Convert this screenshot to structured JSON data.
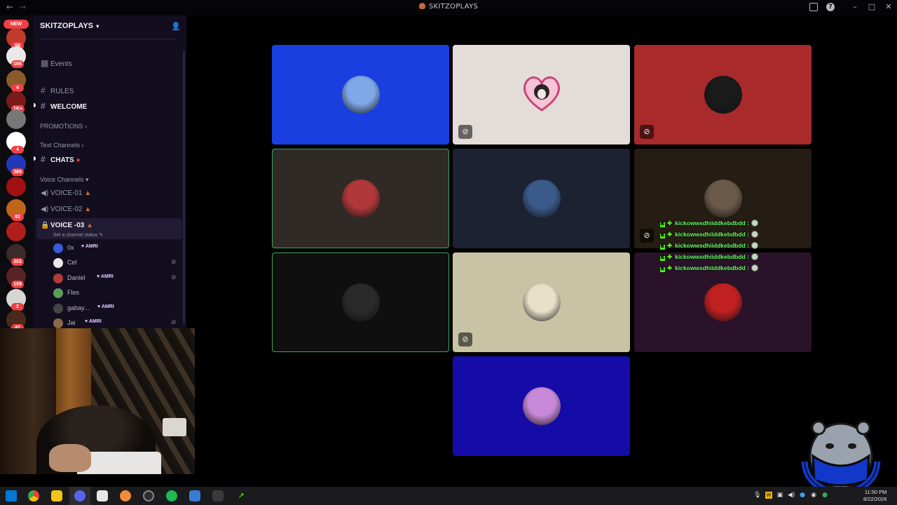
{
  "window": {
    "title": "SKITZOPLAYS"
  },
  "rail": {
    "new_badge": "NEW",
    "servers": [
      {
        "badge": "58",
        "color": "#c0392b"
      },
      {
        "badge": "166",
        "color": "#e9e9e9"
      },
      {
        "badge": "4",
        "color": "#8b5a2b"
      },
      {
        "badge": "1K+",
        "color": "#7a1b1b"
      },
      {
        "badge": "",
        "color": "#777777"
      },
      {
        "badge": "4",
        "color": "#ffffff"
      },
      {
        "badge": "389",
        "color": "#2338b8"
      },
      {
        "badge": "",
        "color": "#a01010"
      },
      {
        "badge": "82",
        "color": "#c0651a"
      },
      {
        "badge": "",
        "color": "#b11d1d"
      },
      {
        "badge": "302",
        "color": "#3a2a2a"
      },
      {
        "badge": "199",
        "color": "#5a2323"
      },
      {
        "badge": "2",
        "color": "#d6d6d6"
      },
      {
        "badge": "42",
        "color": "#4a2a1a"
      }
    ]
  },
  "sidebar": {
    "server_name": "SKITZOPLAYS",
    "events": "Events",
    "channels_top": [
      {
        "name": "RULES",
        "bold": false
      },
      {
        "name": "WELCOME",
        "bold": true
      }
    ],
    "cat_promotions": "PROMOTIONS",
    "cat_text": "Text Channels",
    "chats": "CHATS",
    "cat_voice": "Voice Channels",
    "voice": [
      {
        "name": "VOICE-01"
      },
      {
        "name": "VOICE-02"
      },
      {
        "name": "VOICE -03"
      }
    ],
    "channel_status": "Set a channel status",
    "members": [
      {
        "name": "0x",
        "tag": "AMRI",
        "muted": false,
        "color": "#3a5bd9"
      },
      {
        "name": "Cel",
        "tag": "",
        "muted": true,
        "color": "#e8e8e8"
      },
      {
        "name": "Daniel",
        "tag": "AMRI",
        "muted": true,
        "color": "#b33a3a"
      },
      {
        "name": "Fles",
        "tag": "",
        "muted": false,
        "color": "#5a9a5a"
      },
      {
        "name": "gabay...",
        "tag": "AMRI",
        "muted": false,
        "color": "#444444"
      },
      {
        "name": "Jai",
        "tag": "AMRI",
        "muted": true,
        "color": "#8a6a4a"
      }
    ]
  },
  "tiles": [
    {
      "bg": "#1a3fe0",
      "avatar": "#7fa8e8",
      "muted": false,
      "speaking": false
    },
    {
      "bg": "#e4dcd9",
      "avatar": "heart",
      "muted": true,
      "speaking": false
    },
    {
      "bg": "#a82a2a",
      "avatar": "#1a1a1a",
      "muted": true,
      "speaking": false
    },
    {
      "bg": "#2f2a26",
      "avatar": "#b0383a",
      "muted": false,
      "speaking": true
    },
    {
      "bg": "#1d2233",
      "avatar": "#3a5a8a",
      "muted": false,
      "speaking": false
    },
    {
      "bg": "#251c13",
      "avatar": "#6b5a4a",
      "muted": true,
      "speaking": false
    },
    {
      "bg": "#0f0f0f",
      "avatar": "#2a2a2a",
      "muted": false,
      "speaking": true
    },
    {
      "bg": "#c8c3a4",
      "avatar": "#e8e0c8",
      "muted": true,
      "speaking": false
    },
    {
      "bg": "#2a1328",
      "avatar": "#c02020",
      "muted": false,
      "speaking": false
    },
    {
      "bg": "#150ca8",
      "avatar": "#c88ad8",
      "muted": false,
      "speaking": false
    }
  ],
  "chat_overlay": [
    "kickowwsdhiiddkebdbdd :",
    "kickowwsdhiiddkebdbdd :",
    "kickowwsdhiiddkebdbdd :",
    "kickowwsdhiiddkebdbdd :",
    "kickowwsdhiiddkebdbdd :"
  ],
  "logo_text": "DON'T BLAME THE DAWG",
  "taskbar": {
    "time": "11:50 PM",
    "date": "8/22/2026"
  },
  "colors": {
    "accent_speaking": "#3ba55d",
    "badge_red": "#f23f43"
  }
}
